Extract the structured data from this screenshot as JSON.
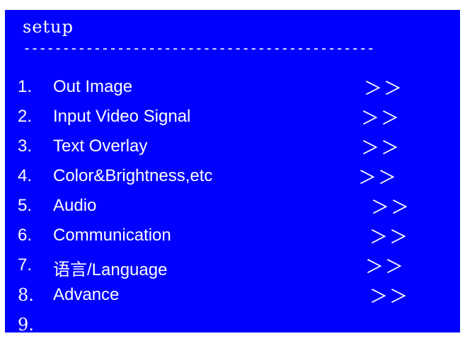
{
  "menu": {
    "title": "setup",
    "divider": "---------------------------------------------",
    "items": [
      {
        "number": "1.",
        "label": "Out Image",
        "arrow": "＞＞"
      },
      {
        "number": "2.",
        "label": "Input Video Signal",
        "arrow": "＞＞"
      },
      {
        "number": "3.",
        "label": "Text Overlay",
        "arrow": "＞＞"
      },
      {
        "number": "4.",
        "label": "Color&Brightness,etc",
        "arrow": "＞＞"
      },
      {
        "number": "5.",
        "label": "Audio",
        "arrow": "＞＞"
      },
      {
        "number": "6.",
        "label": "Communication",
        "arrow": "＞＞"
      },
      {
        "number": "7.",
        "label_cjk": "语言",
        "label": "/Language",
        "arrow": "＞＞"
      },
      {
        "number": "8.",
        "label": "Advance",
        "arrow": "＞＞"
      },
      {
        "number": "9.",
        "label": "",
        "arrow": ""
      }
    ]
  },
  "colors": {
    "background": "#0000fe",
    "text": "#ffffff"
  }
}
